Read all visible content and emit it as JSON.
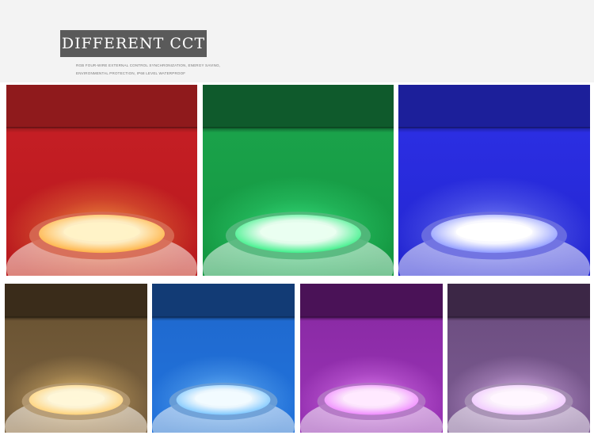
{
  "header": {
    "title": "DIFFERENT CCT",
    "subtitle_line1": "RGB FOUR-WIRE EXTERNAL CONTROL SYNCHRONIZATION, ENERGY SAVING,",
    "subtitle_line2": "ENVIRONMENTAL PROTECTION, IP68 LEVEL WATERPROOF"
  },
  "tiles": [
    {
      "name": "red",
      "bg_top": "#8f1a1c",
      "bg_mid": "#c41e24",
      "bg_bottom": "#b8191d",
      "glow": "#ffb347",
      "core": "#fff3c8",
      "ring": "#d66a54"
    },
    {
      "name": "green",
      "bg_top": "#0f5a2c",
      "bg_mid": "#1aa24a",
      "bg_bottom": "#139640",
      "glow": "#3ef08a",
      "core": "#eafff1",
      "ring": "#55b87d"
    },
    {
      "name": "blue",
      "bg_top": "#1c1f9a",
      "bg_mid": "#2b2ee2",
      "bg_bottom": "#2326d0",
      "glow": "#8f9bff",
      "core": "#ffffff",
      "ring": "#6d6fe0"
    },
    {
      "name": "warm-amber",
      "bg_top": "#3a2c1a",
      "bg_mid": "#6c5534",
      "bg_bottom": "#7a6140",
      "glow": "#ffd27a",
      "core": "#fff7d8",
      "ring": "#b59a72"
    },
    {
      "name": "sky-blue",
      "bg_top": "#123b75",
      "bg_mid": "#1f6ad0",
      "bg_bottom": "#2273dc",
      "glow": "#7fc8ff",
      "core": "#f2fbff",
      "ring": "#6c9fd6"
    },
    {
      "name": "magenta",
      "bg_top": "#4a1257",
      "bg_mid": "#8b2ba6",
      "bg_bottom": "#9a34b6",
      "glow": "#f08cff",
      "core": "#ffe9ff",
      "ring": "#b377c4"
    },
    {
      "name": "lavender",
      "bg_top": "#3c2746",
      "bg_mid": "#6e4f82",
      "bg_bottom": "#7c5b92",
      "glow": "#f0c6ff",
      "core": "#fff6ff",
      "ring": "#a690b4"
    }
  ]
}
